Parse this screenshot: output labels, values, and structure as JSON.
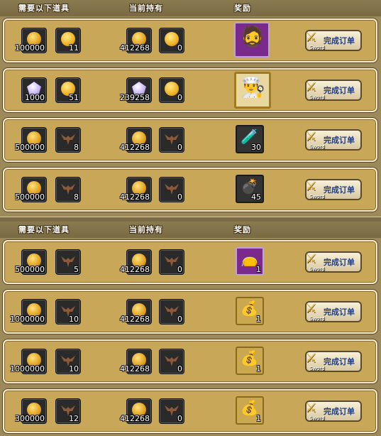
{
  "headers": {
    "need": "需要以下道具",
    "hold": "当前持有",
    "reward": "奖励"
  },
  "button": {
    "label": "完成订单",
    "sub": "Sword"
  },
  "top_rows": [
    {
      "need": [
        {
          "icon": "gold-coin-icon",
          "count": "100000"
        },
        {
          "icon": "token-coin-icon",
          "count": "11"
        }
      ],
      "hold": [
        {
          "icon": "gold-coin-icon",
          "count": "412268"
        },
        {
          "icon": "token-coin-icon",
          "count": "0"
        }
      ],
      "reward": {
        "icon": "warrior-portrait-icon",
        "count": "",
        "style": "big purple"
      }
    },
    {
      "need": [
        {
          "icon": "crystal-icon",
          "count": "1000"
        },
        {
          "icon": "token-coin-icon",
          "count": "51"
        }
      ],
      "hold": [
        {
          "icon": "crystal-icon",
          "count": "239258"
        },
        {
          "icon": "token-coin-icon",
          "count": "0"
        }
      ],
      "reward": {
        "icon": "chef-portrait-icon",
        "count": "",
        "style": "big goldframe"
      }
    },
    {
      "need": [
        {
          "icon": "gold-coin-icon",
          "count": "500000"
        },
        {
          "icon": "wing-emblem-icon",
          "count": "8"
        }
      ],
      "hold": [
        {
          "icon": "gold-coin-icon",
          "count": "412268"
        },
        {
          "icon": "wing-emblem-icon",
          "count": "0"
        }
      ],
      "reward": {
        "icon": "potion-icon",
        "count": "30",
        "style": ""
      }
    },
    {
      "need": [
        {
          "icon": "gold-coin-icon",
          "count": "500000"
        },
        {
          "icon": "wing-emblem-icon",
          "count": "8"
        }
      ],
      "hold": [
        {
          "icon": "gold-coin-icon",
          "count": "412268"
        },
        {
          "icon": "wing-emblem-icon",
          "count": "0"
        }
      ],
      "reward": {
        "icon": "bomb-icon",
        "count": "45",
        "style": ""
      }
    }
  ],
  "bottom_rows": [
    {
      "need": [
        {
          "icon": "gold-coin-icon",
          "count": "500000"
        },
        {
          "icon": "wing-emblem-icon",
          "count": "5"
        }
      ],
      "hold": [
        {
          "icon": "gold-coin-icon",
          "count": "412268"
        },
        {
          "icon": "wing-emblem-icon",
          "count": "0"
        }
      ],
      "reward": {
        "icon": "purple-bag-icon",
        "count": "1",
        "style": "purple"
      }
    },
    {
      "need": [
        {
          "icon": "gold-coin-icon",
          "count": "1000000"
        },
        {
          "icon": "wing-emblem-icon",
          "count": "10"
        }
      ],
      "hold": [
        {
          "icon": "gold-coin-icon",
          "count": "412268"
        },
        {
          "icon": "wing-emblem-icon",
          "count": "0"
        }
      ],
      "reward": {
        "icon": "gold-bag-icon",
        "count": "1",
        "style": "gold"
      }
    },
    {
      "need": [
        {
          "icon": "gold-coin-icon",
          "count": "1000000"
        },
        {
          "icon": "wing-emblem-icon",
          "count": "10"
        }
      ],
      "hold": [
        {
          "icon": "gold-coin-icon",
          "count": "412268"
        },
        {
          "icon": "wing-emblem-icon",
          "count": "0"
        }
      ],
      "reward": {
        "icon": "gold-bag-icon",
        "count": "1",
        "style": "gold"
      }
    },
    {
      "need": [
        {
          "icon": "gold-coin-icon",
          "count": "300000"
        },
        {
          "icon": "wing-emblem-icon",
          "count": "12"
        }
      ],
      "hold": [
        {
          "icon": "gold-coin-icon",
          "count": "412268"
        },
        {
          "icon": "wing-emblem-icon",
          "count": "0"
        }
      ],
      "reward": {
        "icon": "legend-bag-icon",
        "count": "1",
        "style": "gold"
      }
    }
  ]
}
